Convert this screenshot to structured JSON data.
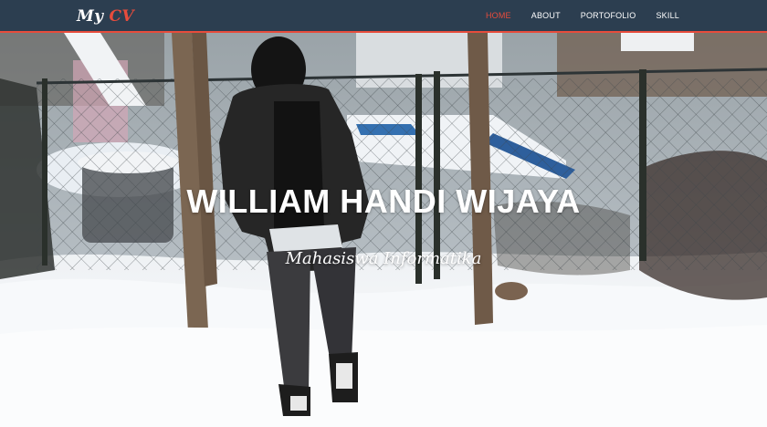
{
  "brand": {
    "part1": "My ",
    "part2": "CV"
  },
  "nav": {
    "items": [
      {
        "label": "HOME",
        "active": true
      },
      {
        "label": "ABOUT",
        "active": false
      },
      {
        "label": "PORTOFOLIO",
        "active": false
      },
      {
        "label": "SKILL",
        "active": false
      }
    ]
  },
  "hero": {
    "title": "WILLIAM HANDI WIJAYA",
    "subtitle": "Mahasiswa Informatika",
    "image": "hero-background-photo"
  },
  "colors": {
    "navbar": "#2c3e50",
    "accent": "#e74c3c",
    "text": "#ffffff"
  }
}
